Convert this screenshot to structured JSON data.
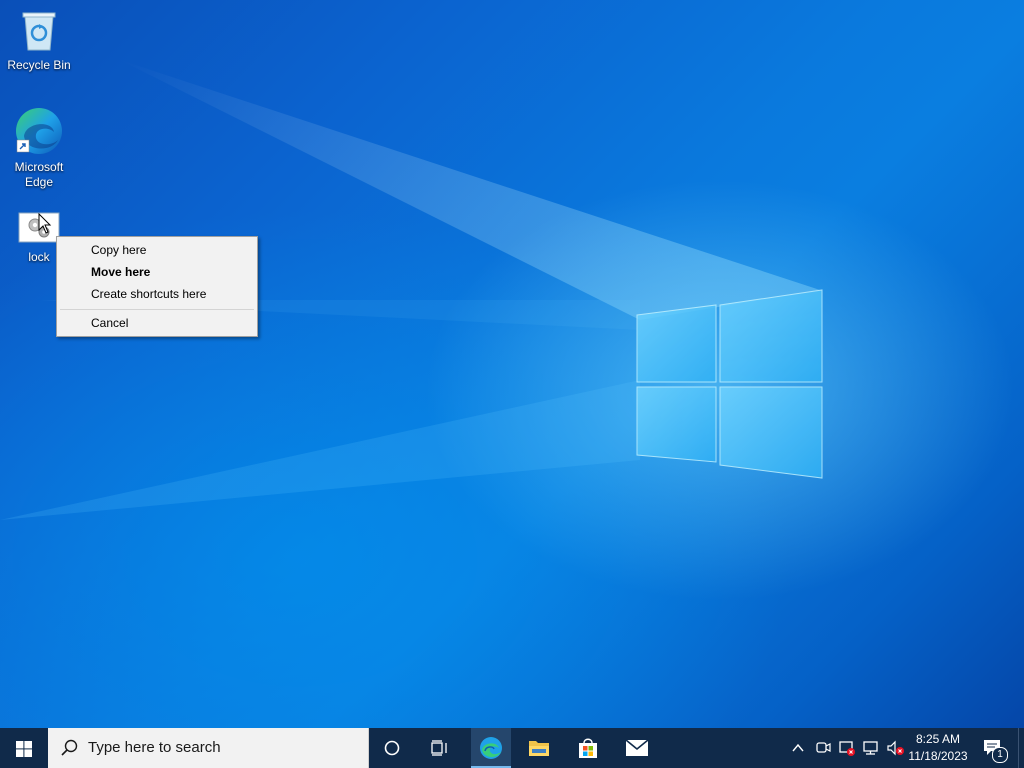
{
  "desktop": {
    "icons": [
      {
        "label": "Recycle Bin"
      },
      {
        "label": "Microsoft Edge"
      },
      {
        "label": "lock"
      }
    ]
  },
  "context_menu": {
    "items": [
      {
        "label": "Copy here"
      },
      {
        "label": "Move here",
        "default": true
      },
      {
        "label": "Create shortcuts here"
      },
      {
        "label": "Cancel"
      }
    ]
  },
  "taskbar": {
    "search_placeholder": "Type here to search",
    "pinned": [
      "microsoft-edge",
      "file-explorer",
      "microsoft-store",
      "mail"
    ],
    "clock": {
      "time": "8:25 AM",
      "date": "11/18/2023"
    },
    "notification_count": "1",
    "colors": {
      "background": "#102a4a",
      "accent": "#76b9ed"
    }
  }
}
